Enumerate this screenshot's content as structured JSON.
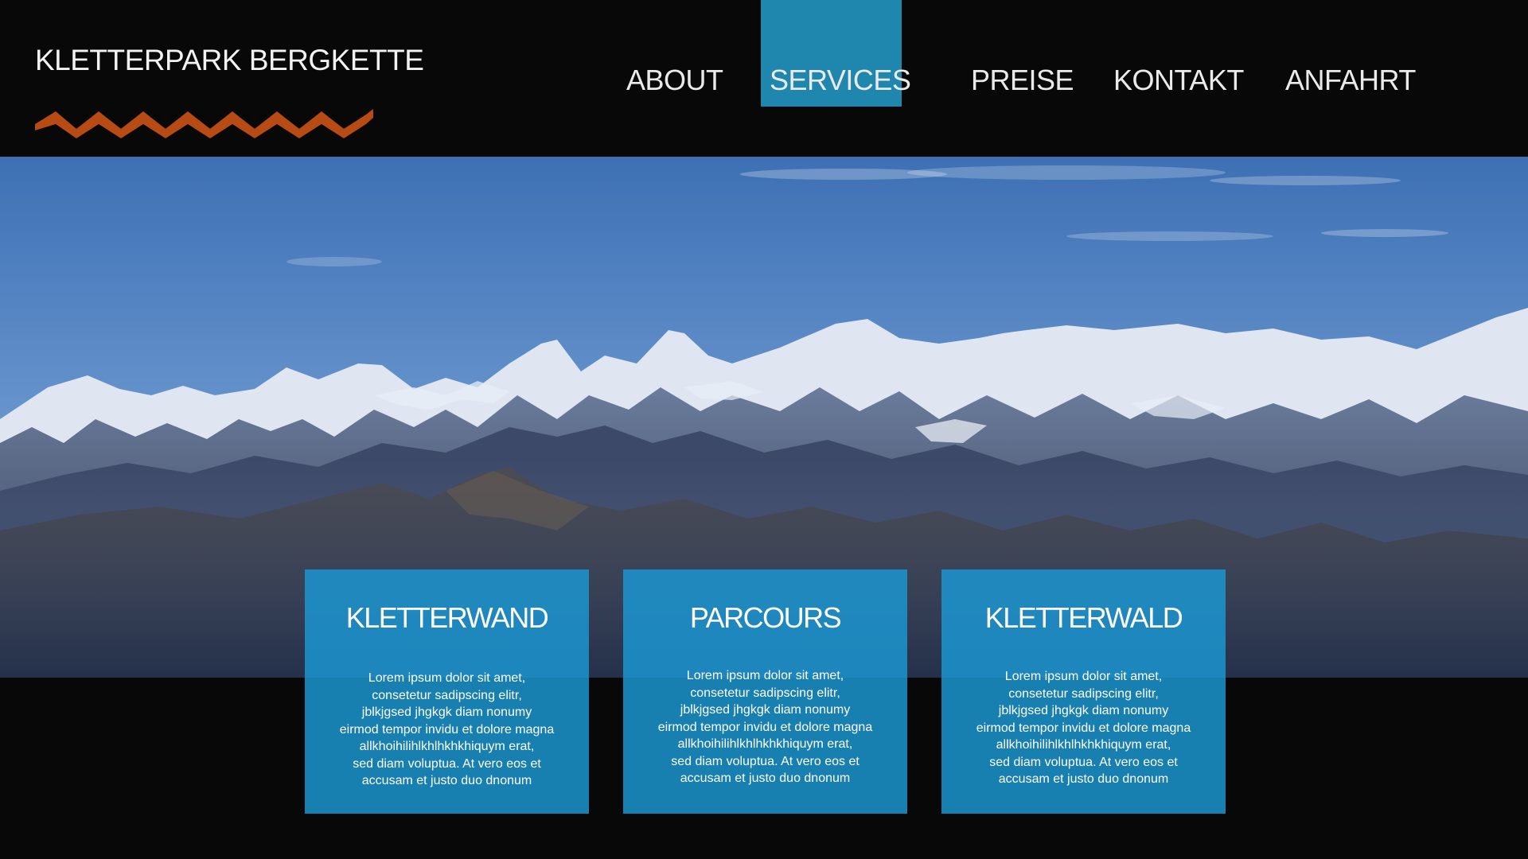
{
  "brand": {
    "title": "KLETTERPARK BERGKETTE",
    "zigzag_color": "#b84a14"
  },
  "nav": {
    "active_color": "#1f86ae",
    "items": [
      {
        "label": "ABOUT",
        "active": false
      },
      {
        "label": "SERVICES",
        "active": true
      },
      {
        "label": "PREISE",
        "active": false
      },
      {
        "label": "KONTAKT",
        "active": false
      },
      {
        "label": "ANFAHRT",
        "active": false
      }
    ]
  },
  "hero": {
    "image": "snow-capped-mountain-panorama"
  },
  "cards": [
    {
      "title": "KLETTERWAND",
      "lines": [
        "Lorem ipsum dolor sit amet,",
        "consetetur sadipscing elitr,",
        "jblkjgsed jhgkgk diam nonumy",
        "eirmod tempor invidu et dolore magna",
        "allkhoihilihlkhlhkhkhiquym erat,",
        "sed diam voluptua. At vero eos et",
        "accusam et justo duo dnonum"
      ]
    },
    {
      "title": "PARCOURS",
      "lines": [
        "Lorem ipsum dolor sit amet,",
        "consetetur sadipscing elitr,",
        "jblkjgsed jhgkgk diam nonumy",
        "eirmod tempor invidu et dolore magna",
        "allkhoihilihlkhlhkhkhiquym erat,",
        "sed diam voluptua. At vero eos et",
        "accusam et justo duo dnonum"
      ]
    },
    {
      "title": "KLETTERWALD",
      "lines": [
        "Lorem ipsum dolor sit amet,",
        "consetetur sadipscing elitr,",
        "jblkjgsed jhgkgk diam nonumy",
        "eirmod tempor invidu et dolore magna",
        "allkhoihilihlkhlhkhkhiquym erat,",
        "sed diam voluptua. At vero eos et",
        "accusam et justo duo dnonum"
      ]
    }
  ],
  "colors": {
    "background": "#080808",
    "card": "#1c96d2",
    "sky_top": "#3f74b8",
    "sky_bottom": "#8ab0da"
  }
}
